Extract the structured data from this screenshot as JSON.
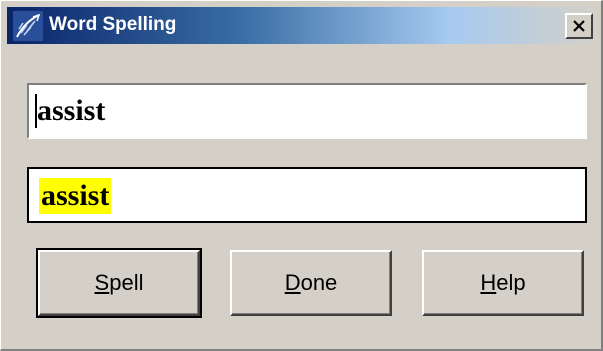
{
  "window": {
    "title": "Word Spelling",
    "icon": "app-feather-icon",
    "close_icon": "close-x-icon"
  },
  "entry": {
    "value": "assist"
  },
  "result": {
    "word": "assist",
    "highlight_color": "#ffff00"
  },
  "buttons": {
    "spell": {
      "mnemonic": "S",
      "rest": "pell"
    },
    "done": {
      "mnemonic": "D",
      "rest": "one"
    },
    "help": {
      "mnemonic": "H",
      "rest": "elp"
    }
  },
  "colors": {
    "title_bar_start": "#0a246a",
    "title_bar_end": "#d4d0c8",
    "dialog_face": "#d4d0c8"
  }
}
